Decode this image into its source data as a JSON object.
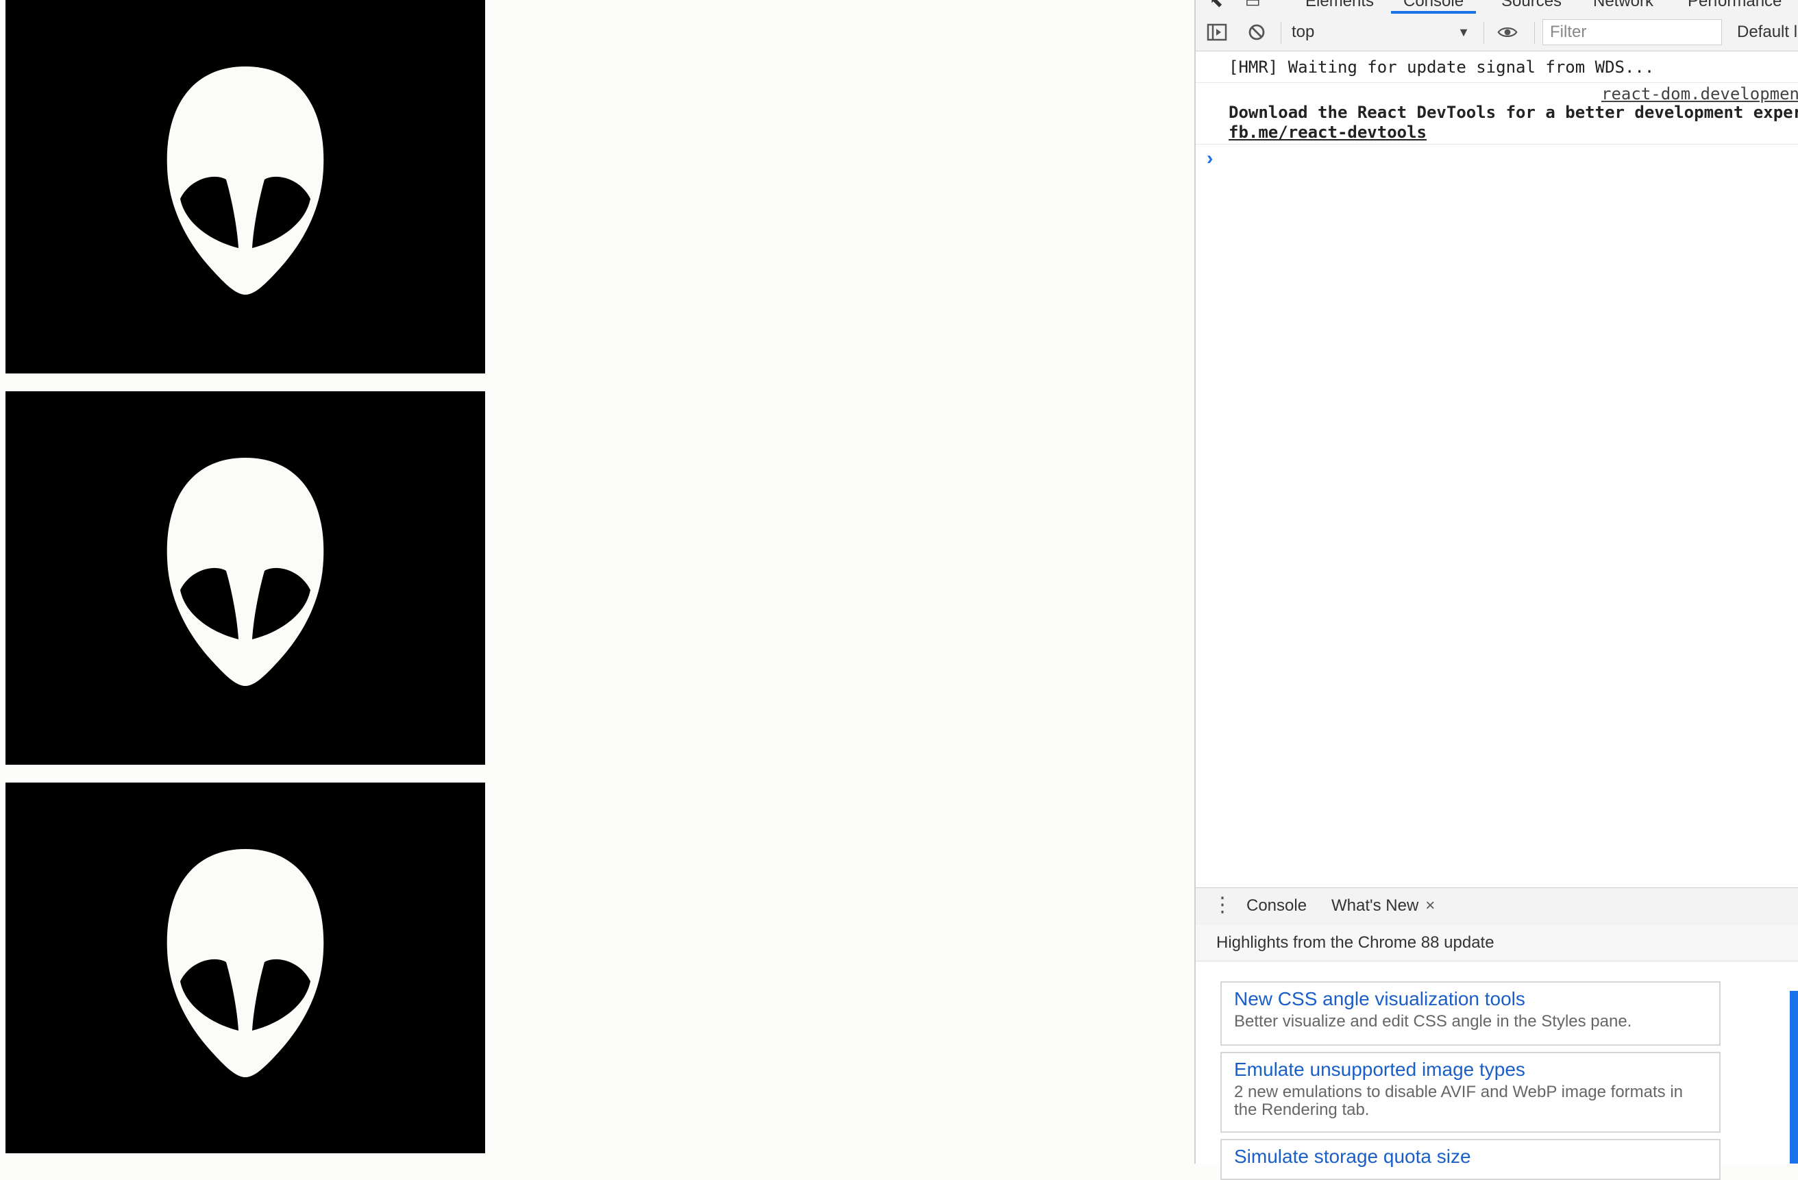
{
  "devtools": {
    "tabs": [
      "Elements",
      "Console",
      "Sources",
      "Network",
      "Performance"
    ],
    "active_tab": "Console",
    "toolbar": {
      "context_value": "top",
      "filter_placeholder": "Filter",
      "levels_label": "Default l"
    },
    "console": {
      "messages": [
        {
          "text": "[HMR] Waiting for update signal from WDS..."
        },
        {
          "source": "react-dom.developmen",
          "text": "Download the React DevTools for a better development exper",
          "link": "fb.me/react-devtools"
        }
      ],
      "prompt": "›"
    },
    "drawer": {
      "tabs": [
        {
          "label": "Console"
        },
        {
          "label": "What's New",
          "close": "×"
        }
      ],
      "whats_new_heading": "Highlights from the Chrome 88 update",
      "cards": [
        {
          "title": "New CSS angle visualization tools",
          "desc": "Better visualize and edit CSS angle in the Styles pane."
        },
        {
          "title": "Emulate unsupported image types",
          "desc": "2 new emulations to disable AVIF and WebP image formats in the Rendering tab."
        },
        {
          "title": "Simulate storage quota size",
          "desc": ""
        }
      ]
    }
  },
  "colors": {
    "accent": "#1a73e8",
    "link_blue": "#1a5fc8",
    "tile_bg": "#000000",
    "alien": "#fbfbf7"
  },
  "icons": [
    "sidebar-toggle-icon",
    "clear-console-icon",
    "eye-icon",
    "kebab-menu-icon",
    "alien-head-icon"
  ]
}
